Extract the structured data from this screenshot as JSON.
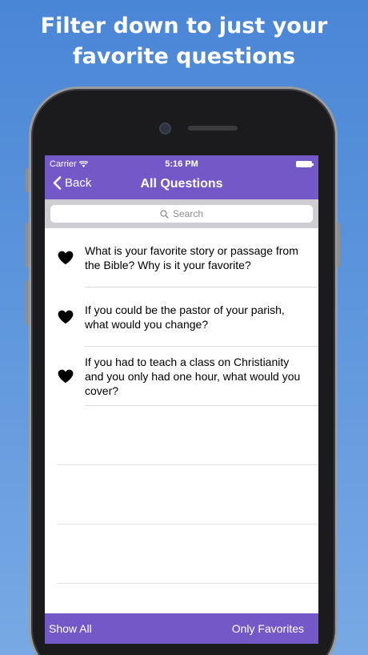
{
  "headline": {
    "line1": "Filter down to just your",
    "line2": "favorite questions"
  },
  "status_bar": {
    "carrier": "Carrier",
    "time": "5:16 PM"
  },
  "nav": {
    "back_label": "Back",
    "title": "All Questions"
  },
  "search": {
    "placeholder": "Search"
  },
  "questions": [
    {
      "text": "What is your favorite story or passage from the Bible? Why is it your favorite?",
      "favorite": true
    },
    {
      "text": "If you could be the pastor of your parish, what would you change?",
      "favorite": true
    },
    {
      "text": "If you had to teach a class on Christianity and you only had one hour, what would you cover?",
      "favorite": true
    }
  ],
  "toolbar": {
    "show_all": "Show All",
    "only_favorites": "Only Favorites"
  },
  "colors": {
    "accent": "#7359c7",
    "background": "#4a86d6"
  }
}
